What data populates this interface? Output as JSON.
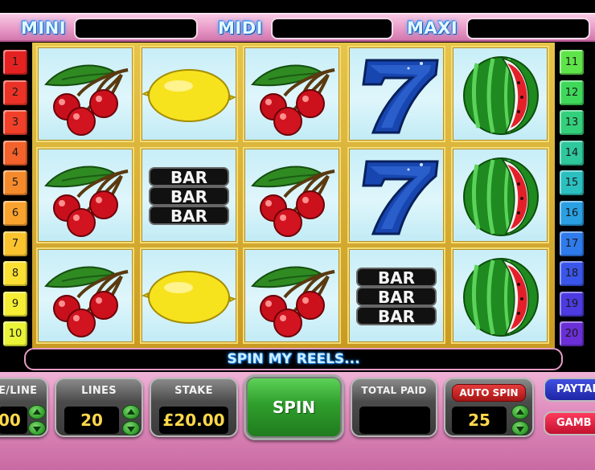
{
  "jackpots": [
    {
      "label": "MINI",
      "value": ""
    },
    {
      "label": "MIDI",
      "value": ""
    },
    {
      "label": "MAXI",
      "value": ""
    }
  ],
  "lines_left": [
    "1",
    "2",
    "3",
    "4",
    "5",
    "6",
    "7",
    "8",
    "9",
    "10"
  ],
  "lines_right": [
    "11",
    "12",
    "13",
    "14",
    "15",
    "16",
    "17",
    "18",
    "19",
    "20"
  ],
  "line_colors_left": [
    "#e52222",
    "#ea3326",
    "#f0402a",
    "#f2622a",
    "#f58a2c",
    "#f9a32e",
    "#fbc42f",
    "#fbe033",
    "#f6ee34",
    "#e9f536"
  ],
  "line_colors_right": [
    "#5fe34a",
    "#3fd85a",
    "#34cf7b",
    "#2fc79c",
    "#2bbfc0",
    "#2a9fe2",
    "#2f7bec",
    "#3a56ea",
    "#4b3be0",
    "#6a2fd6"
  ],
  "reels": [
    [
      "cherries",
      "cherries",
      "cherries"
    ],
    [
      "lemon",
      "bar",
      "lemon"
    ],
    [
      "cherries",
      "cherries",
      "cherries"
    ],
    [
      "seven",
      "seven",
      "bar"
    ],
    [
      "watermelon",
      "watermelon",
      "watermelon"
    ]
  ],
  "bar_text": "BAR",
  "seven_text": "7",
  "message": "SPIN MY REELS...",
  "controls": {
    "bet_per_line": {
      "label": "E/LINE",
      "value": "00"
    },
    "lines": {
      "label": "LINES",
      "value": "20"
    },
    "stake": {
      "label": "STAKE",
      "value": "£20.00"
    },
    "spin": {
      "label": "SPIN"
    },
    "total_paid": {
      "label": "TOTAL PAID",
      "value": ""
    },
    "auto_spin": {
      "label": "AUTO SPIN",
      "value": "25"
    },
    "paytable": {
      "label": "PAYTAB"
    },
    "gamble": {
      "label": "GAMB"
    }
  }
}
